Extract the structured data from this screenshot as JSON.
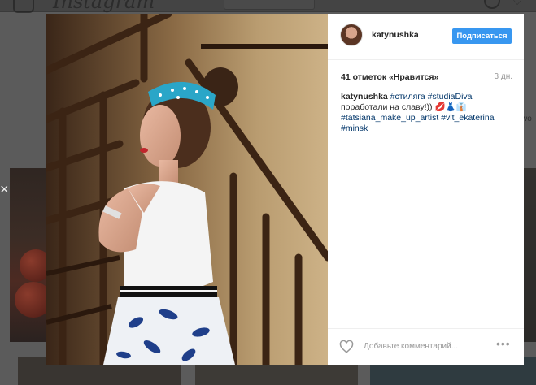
{
  "app": {
    "wordmark": "Instagram"
  },
  "background": {
    "side_text": "wo"
  },
  "post": {
    "username": "katynushka",
    "follow_label": "Подписаться",
    "likes_text": "41 отметок «Нравится»",
    "age": "3 дн.",
    "caption": {
      "username": "katynushka",
      "tags_line1": [
        "#стиляга",
        "#studiaDiva"
      ],
      "text": "поработали на славу!)) 💋👗👔",
      "tags_line3": [
        "#tatsiana_make_up_artist",
        "#vit_ekaterina"
      ],
      "tags_line4": [
        "#minsk"
      ]
    },
    "comment_placeholder": "Добавьте комментарий...",
    "more_label": "•••"
  },
  "colors": {
    "accent": "#3897f0",
    "hashtag": "#003569",
    "overlay": "#5b5b5b"
  },
  "icons": {
    "like": "heart-icon",
    "more": "more-icon",
    "close": "close-icon"
  }
}
